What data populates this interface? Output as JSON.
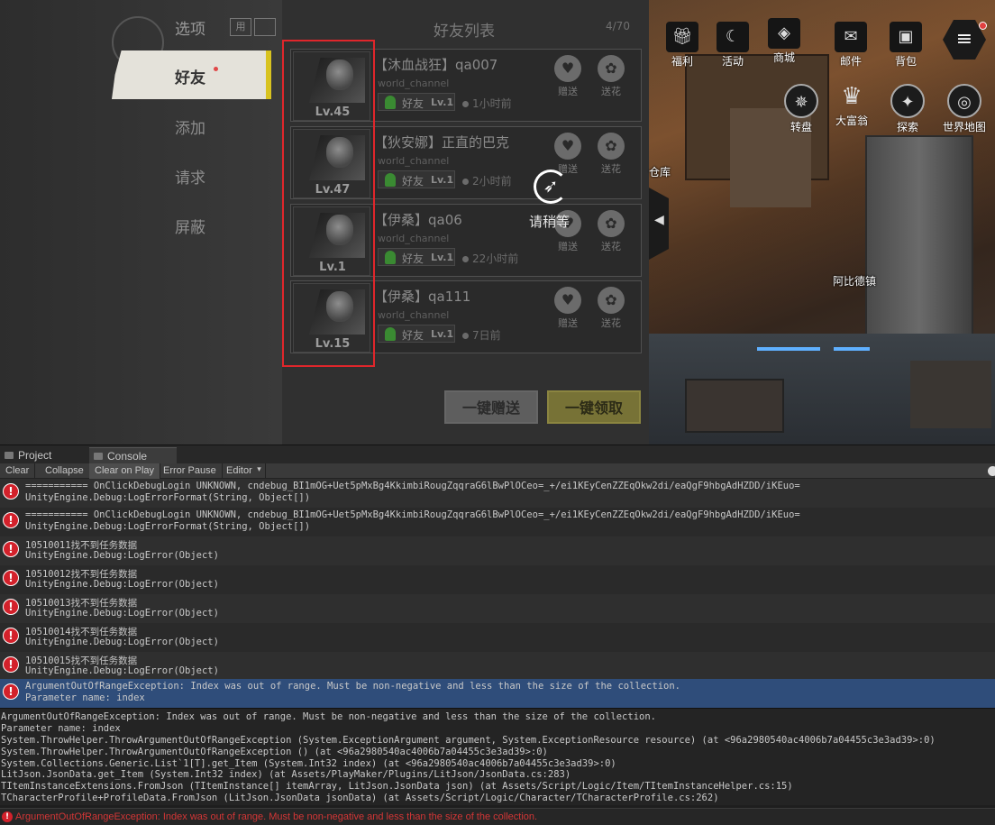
{
  "game": {
    "left_menu": {
      "title": "选项",
      "tag": "用",
      "active_item": "好友",
      "items": [
        "添加",
        "请求",
        "屏蔽"
      ]
    },
    "panel": {
      "title": "好友列表",
      "count": "4/70"
    },
    "friends": [
      {
        "name": "【沐血战狂】qa007",
        "channel": "world_channel",
        "badge": "好友",
        "badge_lv": "Lv.1",
        "online": "1小时前",
        "level": "Lv.45",
        "gift": "赠送",
        "flower": "送花"
      },
      {
        "name": "【狄安娜】正直的巴克",
        "channel": "world_channel",
        "badge": "好友",
        "badge_lv": "Lv.1",
        "online": "2小时前",
        "level": "Lv.47",
        "gift": "赠送",
        "flower": "送花"
      },
      {
        "name": "【伊桑】qa06",
        "channel": "world_channel",
        "badge": "好友",
        "badge_lv": "Lv.1",
        "online": "22小时前",
        "level": "Lv.1",
        "gift": "赠送",
        "flower": "送花"
      },
      {
        "name": "【伊桑】qa111",
        "channel": "world_channel",
        "badge": "好友",
        "badge_lv": "Lv.1",
        "online": "7日前",
        "level": "Lv.15",
        "gift": "赠送",
        "flower": "送花"
      }
    ],
    "buttons": {
      "gift_all": "一键赠送",
      "claim_all": "一键领取"
    },
    "loading_text": "请稍等",
    "top_icons": [
      {
        "label": "福利",
        "icon": "gift-icon"
      },
      {
        "label": "活动",
        "icon": "moon-icon"
      },
      {
        "label": "商城",
        "icon": "bag-icon"
      },
      {
        "label": "邮件",
        "icon": "mail-icon"
      },
      {
        "label": "背包",
        "icon": "backpack-icon"
      }
    ],
    "second_icons": [
      {
        "label": "转盘",
        "icon": "wheel-icon"
      },
      {
        "label": "大富翁",
        "icon": "hat-icon"
      },
      {
        "label": "探索",
        "icon": "compass-icon"
      },
      {
        "label": "世界地图",
        "icon": "globe-icon"
      }
    ],
    "scene_labels": {
      "warehouse": "仓库",
      "town": "阿比德镇"
    }
  },
  "editor": {
    "tabs": {
      "project": "Project",
      "console": "Console"
    },
    "toolbar": {
      "clear": "Clear",
      "collapse": "Collapse",
      "clear_on_play": "Clear on Play",
      "error_pause": "Error Pause",
      "editor": "Editor"
    },
    "logs": [
      {
        "line1": "=========== OnClickDebugLogin UNKNOWN, cndebug_BI1mOG+Uet5pMxBg4KkimbiRougZqqraG6lBwPlOCeo=_+/ei1KEyCenZZEqOkw2di/eaQgF9hbgAdHZDD/iKEuo=",
        "line2": "UnityEngine.Debug:LogErrorFormat(String, Object[])"
      },
      {
        "line1": "=========== OnClickDebugLogin UNKNOWN, cndebug_BI1mOG+Uet5pMxBg4KkimbiRougZqqraG6lBwPlOCeo=_+/ei1KEyCenZZEqOkw2di/eaQgF9hbgAdHZDD/iKEuo=",
        "line2": "UnityEngine.Debug:LogErrorFormat(String, Object[])"
      },
      {
        "line1": "10510011找不到任务数据",
        "line2": "UnityEngine.Debug:LogError(Object)"
      },
      {
        "line1": "10510012找不到任务数据",
        "line2": "UnityEngine.Debug:LogError(Object)"
      },
      {
        "line1": "10510013找不到任务数据",
        "line2": "UnityEngine.Debug:LogError(Object)"
      },
      {
        "line1": "10510014找不到任务数据",
        "line2": "UnityEngine.Debug:LogError(Object)"
      },
      {
        "line1": "10510015找不到任务数据",
        "line2": "UnityEngine.Debug:LogError(Object)"
      },
      {
        "line1": "ArgumentOutOfRangeException: Index was out of range. Must be non-negative and less than the size of the collection.",
        "line2": "Parameter name: index"
      }
    ],
    "stacktrace": [
      "ArgumentOutOfRangeException: Index was out of range. Must be non-negative and less than the size of the collection.",
      "Parameter name: index",
      "System.ThrowHelper.ThrowArgumentOutOfRangeException (System.ExceptionArgument argument, System.ExceptionResource resource) (at <96a2980540ac4006b7a04455c3e3ad39>:0)",
      "System.ThrowHelper.ThrowArgumentOutOfRangeException () (at <96a2980540ac4006b7a04455c3e3ad39>:0)",
      "System.Collections.Generic.List`1[T].get_Item (System.Int32 index) (at <96a2980540ac4006b7a04455c3e3ad39>:0)",
      "LitJson.JsonData.get_Item (System.Int32 index) (at Assets/PlayMaker/Plugins/LitJson/JsonData.cs:283)",
      "TItemInstanceExtensions.FromJson (TItemInstance[] itemArray, LitJson.JsonData json) (at Assets/Script/Logic/Item/TItemInstanceHelper.cs:15)",
      "TCharacterProfile+ProfileData.FromJson (LitJson.JsonData jsonData) (at Assets/Script/Logic/Character/TCharacterProfile.cs:262)"
    ],
    "status": "ArgumentOutOfRangeException: Index was out of range. Must be non-negative and less than the size of the collection."
  }
}
